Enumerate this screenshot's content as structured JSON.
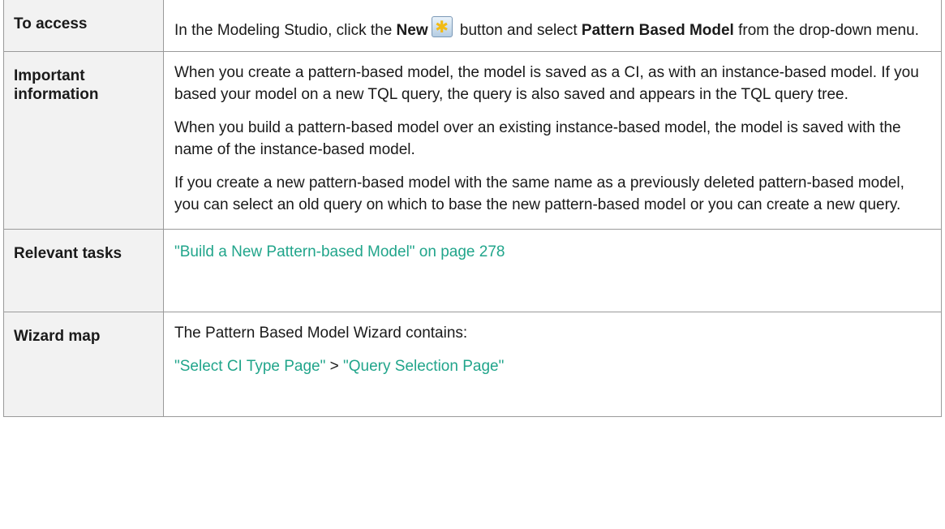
{
  "rows": [
    {
      "label": "To access",
      "content": {
        "t1": "In the Modeling Studio, click the ",
        "new_bold": "New",
        "new_icon": "new-icon",
        "t2": " button and select ",
        "model_bold": "Pattern Based Model",
        "t3": " from the drop-down menu."
      }
    },
    {
      "label": "Important information",
      "paragraphs": [
        "When you create a pattern-based model, the model is saved as a CI, as with an instance-based model. If you based your model on a new TQL query, the query is also saved and appears in the TQL query tree.",
        "When you build a pattern-based model over an existing instance-based model, the model is saved with the name of the instance-based model.",
        "If you create a new pattern-based model with the same name as a previously deleted pattern-based model, you can select an old query on which to base the new pattern-based model or you can create a new query."
      ]
    },
    {
      "label": "Relevant tasks",
      "link": "\"Build a New Pattern-based Model\" on page 278"
    },
    {
      "label": "Wizard map",
      "intro": "The Pattern Based Model Wizard contains:",
      "link1": "\"Select CI Type Page\"",
      "separator": " > ",
      "link2": "\"Query Selection Page\""
    }
  ],
  "colors": {
    "link": "#21a58b",
    "label_bg": "#f2f2f2",
    "border": "#9a9a9a"
  }
}
